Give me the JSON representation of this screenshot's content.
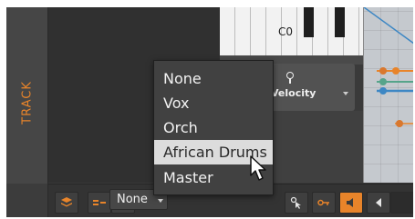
{
  "track_panel": {
    "label": "TRACK",
    "accent": "#e8842a"
  },
  "piano": {
    "octave_label": "C0"
  },
  "velocity_control": {
    "label": "Velocity"
  },
  "dropdown_menu": {
    "items": [
      {
        "label": "None"
      },
      {
        "label": "Vox"
      },
      {
        "label": "Orch"
      },
      {
        "label": "African Drums",
        "hovered": true
      },
      {
        "label": "Master"
      }
    ]
  },
  "bottom_toolbar": {
    "routing_select": {
      "value": "None"
    },
    "buttons": [
      {
        "icon": "layers-icon"
      },
      {
        "icon": "split-view-icon"
      },
      {
        "icon": "waveform-icon"
      },
      {
        "icon": "pointer-tool-icon"
      },
      {
        "icon": "key-icon"
      },
      {
        "icon": "speaker-icon"
      },
      {
        "icon": "arrow-left-icon"
      }
    ]
  },
  "colors": {
    "accent_orange": "#e8842a",
    "automation_blue": "#3d87c4",
    "automation_teal": "#56a48a",
    "dot_orange": "#d9782e"
  }
}
